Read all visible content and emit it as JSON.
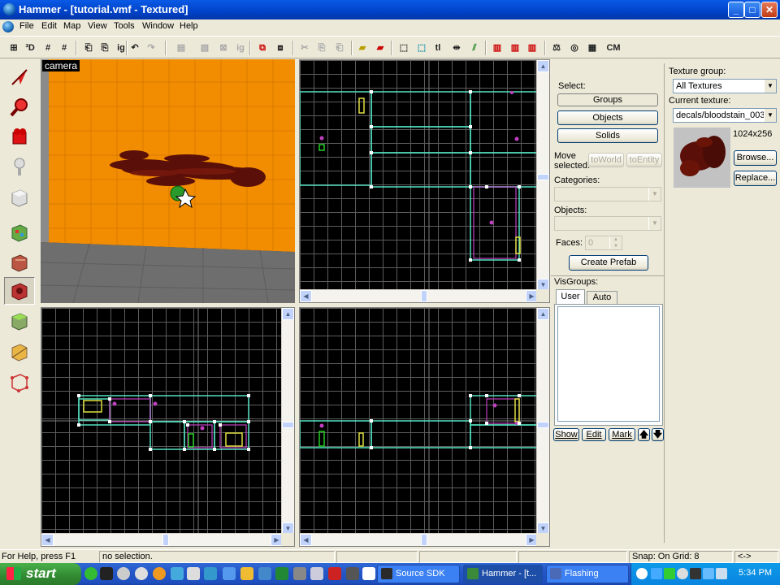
{
  "window": {
    "title": "Hammer - [tutorial.vmf - Textured]",
    "controls": {
      "minimize": "_",
      "maximize": "□",
      "close": "✕"
    }
  },
  "menu": {
    "items": [
      "File",
      "Edit",
      "Map",
      "View",
      "Tools",
      "Window",
      "Help"
    ],
    "mdi_controls": [
      "_",
      "❐",
      "✕"
    ]
  },
  "toolbar": {
    "buttons": [
      "⊞",
      "³D",
      "#",
      "#",
      "⎗",
      "⎘",
      "ig",
      "↶",
      "↷",
      "▤",
      "▧",
      "⊠",
      "ig",
      "⧉",
      "⧈",
      "✂",
      "⎘",
      "⎗",
      "▰",
      "▰",
      "⬚",
      "⬚",
      "tl",
      "⇹",
      "⫽",
      "▥",
      "▥",
      "▥",
      "⚖",
      "◎",
      "▦",
      "CM"
    ]
  },
  "tools": {
    "items": [
      "selection-tool",
      "magnify-tool",
      "camera-tool",
      "entity-tool",
      "block-tool",
      "texture-application-tool",
      "apply-current-texture-tool",
      "apply-decals-tool",
      "apply-overlays-tool",
      "clipping-tool",
      "vertex-manipulation-tool"
    ]
  },
  "camera": {
    "label": "camera"
  },
  "object_panel": {
    "select_label": "Select:",
    "groups_button": "Groups",
    "objects_button": "Objects",
    "solids_button": "Solids",
    "move_selected_label_1": "Move",
    "move_selected_label_2": "selected:",
    "to_world_button": "toWorld",
    "to_entity_button": "toEntity",
    "categories_label": "Categories:",
    "categories_value": "",
    "objects_label": "Objects:",
    "objects_value": "",
    "faces_label": "Faces:",
    "faces_value": "0",
    "create_prefab_button": "Create Prefab",
    "visgroups_label": "VisGroups:",
    "visgroups_tabs": [
      "User",
      "Auto"
    ],
    "show_button": "Show",
    "edit_button": "Edit",
    "mark_button": "Mark",
    "up_button": "🡅",
    "down_button": "🡇"
  },
  "texture_panel": {
    "texture_group_label": "Texture group:",
    "texture_group_value": "All Textures",
    "current_texture_label": "Current texture:",
    "current_texture_value": "decals/bloodstain_003",
    "texture_size": "1024x256",
    "browse_button": "Browse...",
    "replace_button": "Replace..."
  },
  "status": {
    "help_text": "For Help, press F1",
    "selection_text": "no selection.",
    "snap_text": "Snap: On Grid: 8",
    "extra_text": "<->"
  },
  "taskbar": {
    "start_label": "start",
    "tasks": [
      {
        "label": "Source SDK",
        "icon_color": "#2a2a2a"
      },
      {
        "label": "Hammer - [t...",
        "icon_color": "#3a8a3a"
      },
      {
        "label": "Flashing",
        "icon_color": "#4a6ab8"
      }
    ],
    "clock": "5:34 PM"
  },
  "colors": {
    "orange_wall": "#f28c00",
    "floor": "#6e6e6e",
    "blood": "#5a0f08",
    "brush_outline": "#54e0c0",
    "selection_magenta": "#c040c0",
    "entity_yellow": "#e0e040"
  }
}
